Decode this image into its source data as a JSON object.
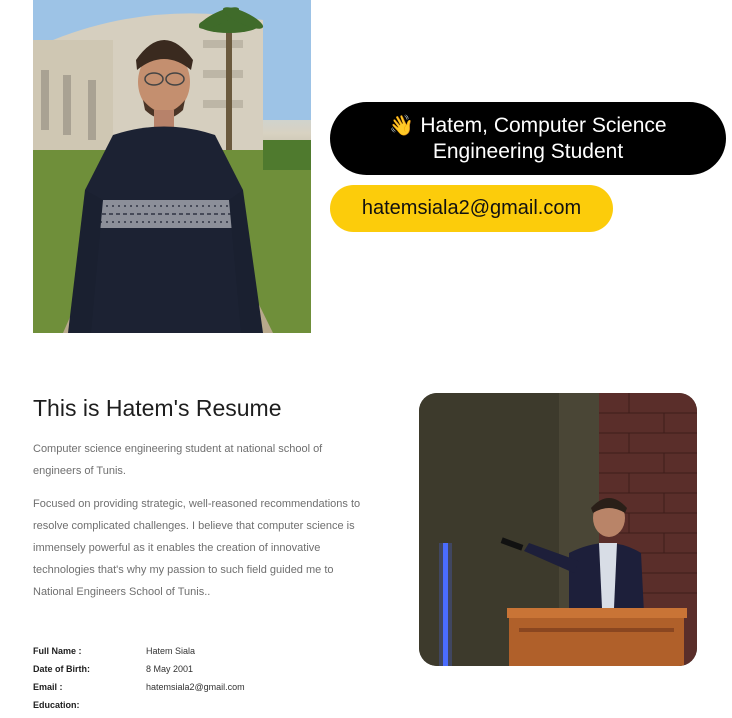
{
  "hero": {
    "greeting_emoji": "👋",
    "greeting": "Hatem, Computer Science Engineering Student",
    "email": "hatemsiala2@gmail.com"
  },
  "resume": {
    "title": "This is Hatem's Resume",
    "paragraph_1": "Computer science engineering student at national school of engineers of Tunis.",
    "paragraph_2": "Focused on providing strategic, well-reasoned recommendations to resolve complicated challenges. I believe that computer science is immensely powerful as it enables the creation of innovative technologies that's why my passion to such field guided me to National Engineers School of Tunis..",
    "info": [
      {
        "label": "Full Name :",
        "value": "Hatem Siala"
      },
      {
        "label": "Date of Birth:",
        "value": "8 May 2001"
      },
      {
        "label": "Email :",
        "value": "hatemsiala2@gmail.com"
      },
      {
        "label": "Education:",
        "value": ""
      }
    ]
  },
  "colors": {
    "greeting_pill_bg": "#000000",
    "email_pill_bg": "#fccc0b"
  }
}
